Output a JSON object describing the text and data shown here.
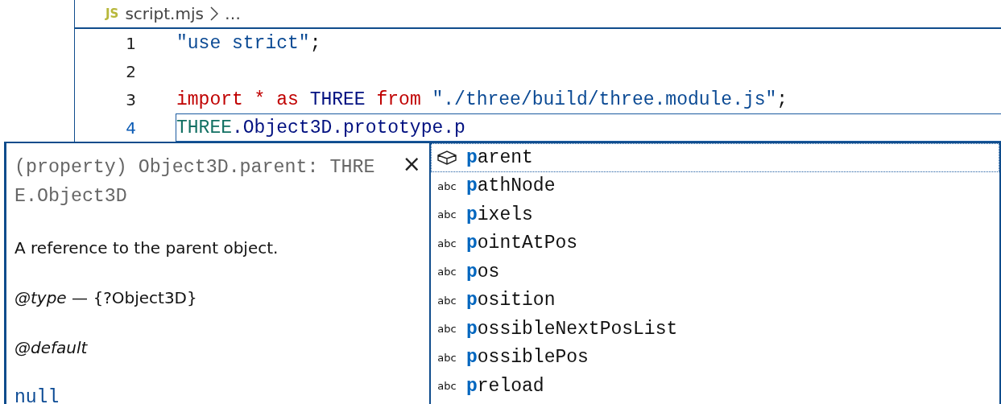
{
  "breadcrumb": {
    "file_icon": "JS",
    "file": "script.mjs",
    "rest": "…"
  },
  "editor": {
    "lines": [
      {
        "number": "1",
        "current": false,
        "tokens": [
          {
            "kind": "string",
            "text": "\"use strict\""
          },
          {
            "kind": "plain",
            "text": ";"
          }
        ]
      },
      {
        "number": "2",
        "current": false
      },
      {
        "number": "3",
        "current": false,
        "tokens": [
          {
            "kind": "keyword",
            "text": "import * as "
          },
          {
            "kind": "variable",
            "text": "THREE "
          },
          {
            "kind": "keyword",
            "text": "from "
          },
          {
            "kind": "string",
            "text": "\"./three/build/three.module.js\""
          },
          {
            "kind": "plain",
            "text": ";"
          }
        ]
      },
      {
        "number": "4",
        "current": true,
        "tokens": [
          {
            "kind": "type",
            "text": "THREE"
          },
          {
            "kind": "variable",
            "text": ".Object3D.prototype.p"
          }
        ]
      }
    ]
  },
  "hover": {
    "signature": "(property) Object3D.parent: THREE.Object3D",
    "close": "×",
    "paragraphs": [
      {
        "kind": "text",
        "text": "A reference to the parent object."
      },
      {
        "kind": "tag",
        "tag": "@type",
        "detail": "— {?Object3D}"
      },
      {
        "kind": "tag",
        "tag": "@default"
      },
      {
        "kind": "code",
        "text": "null"
      }
    ]
  },
  "suggestions": [
    {
      "kind": "property",
      "label": "**p**arent",
      "selected": true
    },
    {
      "kind": "text",
      "icon": "abc",
      "label": "**p**athNode",
      "selected": false
    },
    {
      "kind": "text",
      "icon": "abc",
      "label": "**p**ixels",
      "selected": false
    },
    {
      "kind": "text",
      "icon": "abc",
      "label": "**p**ointAtPos",
      "selected": false
    },
    {
      "kind": "text",
      "icon": "abc",
      "label": "**p**os",
      "selected": false
    },
    {
      "kind": "text",
      "icon": "abc",
      "label": "**p**osition",
      "selected": false
    },
    {
      "kind": "text",
      "icon": "abc",
      "label": "**p**ossibleNextPosList",
      "selected": false
    },
    {
      "kind": "text",
      "icon": "abc",
      "label": "**p**ossiblePos",
      "selected": false
    },
    {
      "kind": "text",
      "icon": "abc",
      "label": "**p**reload",
      "selected": false
    }
  ]
}
